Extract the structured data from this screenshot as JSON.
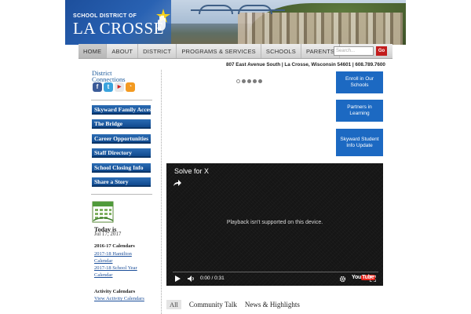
{
  "header": {
    "logo_small": "SCHOOL DISTRICT OF",
    "logo_big": "LA CROSSE"
  },
  "nav": {
    "items": [
      "HOME",
      "ABOUT",
      "DISTRICT",
      "PROGRAMS & SERVICES",
      "SCHOOLS",
      "PARENTS"
    ],
    "active": "HOME",
    "search_placeholder": "Search...",
    "go_label": "Go"
  },
  "address": "807 East Avenue South | La Crosse, Wisconsin 54601 | 608.789.7600",
  "sidebar": {
    "connections_title_1": "District",
    "connections_title_2": "Connections",
    "social": [
      {
        "name": "facebook-icon",
        "glyph": "f",
        "color": "#3b5b98"
      },
      {
        "name": "twitter-icon",
        "glyph": "t",
        "color": "#3aa3dd"
      },
      {
        "name": "youtube-icon",
        "glyph": "You",
        "color": "#d31f1f"
      },
      {
        "name": "rss-icon",
        "glyph": ")",
        "color": "#f39a21"
      }
    ],
    "buttons": [
      "Skyward Family Access",
      "The Bridge",
      "Career Opportunities",
      "Staff Directory",
      "School Closing Info",
      "Share a Story"
    ],
    "today_label": "Today is",
    "today_date": "Jul 17, 2017",
    "calendars_heading": "2016-17 Calendars",
    "calendar_links": [
      "2017-18 Hamilton",
      "Calendar",
      "2017-18 School Year",
      "Calendar"
    ],
    "activity_heading": "Activity Calendars",
    "activity_link": "View Activity Calendars"
  },
  "slider": {
    "dot_count": 5,
    "active_index": 0
  },
  "quick_links": [
    "Enroll in Our Schools",
    "Partners in Learning",
    "Skyward Student Info Update"
  ],
  "video": {
    "title": "Solve for X",
    "message": "Playback isn't supported on this device.",
    "time": "0:00 / 0:31",
    "brand": "YouTube"
  },
  "tabs": [
    "All",
    "Community Talk",
    "News & Highlights"
  ],
  "colors": {
    "accent_blue": "#1c69c2",
    "sidebar_blue": "#104a8f",
    "go_red": "#c21d1d"
  }
}
